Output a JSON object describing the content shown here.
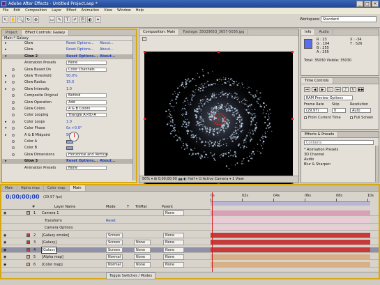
{
  "window": {
    "title": "Adobe After Effects - Untitled Project.aep *",
    "buttons": [
      "_",
      "□",
      "×"
    ]
  },
  "menu": [
    "File",
    "Edit",
    "Composition",
    "Layer",
    "Effect",
    "Animation",
    "View",
    "Window",
    "Help"
  ],
  "toolbar": {
    "workspace_label": "Workspace:",
    "workspace_value": "Standard",
    "tools": [
      "↖",
      "✋",
      "🔍",
      "↻",
      "⊕",
      "▭",
      "✎",
      "T",
      "✐",
      "⎘",
      "◐",
      "✦"
    ]
  },
  "effects_panel": {
    "tabs": [
      "Project",
      "Effect Controls: Galaxy"
    ],
    "subheader": "Main * Galaxy",
    "rows": [
      {
        "label": "Glow",
        "val": "Reset Options...",
        "val2": "About...",
        "head": false,
        "tri": "▸"
      },
      {
        "label": "Glow",
        "val": "Reset Options...",
        "val2": "About...",
        "head": false,
        "tri": "▸"
      },
      {
        "label": "Glow 2",
        "val": "Reset Options...",
        "val2": "About...",
        "head": true,
        "tri": "▾"
      },
      {
        "label": "Animation Presets",
        "dd": "None",
        "head": false,
        "tri": ""
      },
      {
        "label": "Glow Based On",
        "dd": "Color Channels",
        "head": false,
        "tri": "",
        "sw": true
      },
      {
        "label": "Glow Threshold",
        "val": "50.0%",
        "head": false,
        "tri": "▸",
        "sw": true
      },
      {
        "label": "Glow Radius",
        "val": "15.0",
        "head": false,
        "tri": "▸",
        "sw": true
      },
      {
        "label": "Glow Intensity",
        "val": "1.0",
        "head": false,
        "tri": "▸",
        "sw": true
      },
      {
        "label": "Composite Original",
        "dd": "Behind",
        "head": false,
        "tri": "",
        "sw": true
      },
      {
        "label": "Glow Operation",
        "dd": "Add",
        "head": false,
        "tri": "",
        "sw": true
      },
      {
        "label": "Glow Colors",
        "dd": "A & B Colors",
        "head": false,
        "tri": "",
        "sw": true
      },
      {
        "label": "Color Looping",
        "dd": "Triangle A>B>A",
        "head": false,
        "tri": "",
        "sw": true
      },
      {
        "label": "Color Loops",
        "val": "1.0",
        "head": false,
        "tri": "▸",
        "sw": true
      },
      {
        "label": "Color Phase",
        "val": "0x +0.0°",
        "head": false,
        "tri": "▾",
        "sw": true
      },
      {
        "label": "A & B Midpoint",
        "val": "50%",
        "head": false,
        "tri": "▸",
        "sw": true
      },
      {
        "label": "Color A",
        "chip": true,
        "head": false,
        "tri": "",
        "sw": true
      },
      {
        "label": "Color B",
        "chip": true,
        "head": false,
        "tri": "",
        "sw": true
      },
      {
        "label": "Glow Dimensions",
        "dd": "Horizontal and Vertical",
        "head": false,
        "tri": "",
        "sw": true
      },
      {
        "label": "Glow 3",
        "val": "Reset Options...",
        "val2": "About...",
        "head": true,
        "tri": "▸"
      },
      {
        "label": "Animation Presets",
        "dd": "None",
        "head": false,
        "tri": ""
      }
    ]
  },
  "comp_panel": {
    "tabs": [
      "Composition: Main",
      "Footage: 35029653_3657-5036.jpg"
    ],
    "active_camera": "Active Camera",
    "bottom_bar": "50%  ▾  ⊞  0;00;00;00  📷  ◐  Half  ▾  ⊡  Active Camera  ▾  1 View"
  },
  "info_panel": {
    "tabs": [
      "Info",
      "Audio"
    ],
    "r": "R : 23",
    "g": "G : 104",
    "b": "B : 255",
    "a": "A : 255",
    "x": "X : -34",
    "y": "Y : 526",
    "line1": "Total: 35030  Visible: 35030",
    "swatch": "#5a6cf0"
  },
  "time_panel": {
    "tabs": [
      "Time Controls"
    ],
    "ram_preview": "RAM Preview Options",
    "frame_rate_label": "Frame Rate",
    "skip_label": "Skip",
    "resolution_label": "Resolution",
    "frame_rate_val": "(29.97)",
    "skip_val": "0",
    "resolution_val": "Auto",
    "from_current": "From Current Time",
    "full_screen": "Full Screen"
  },
  "presets_panel": {
    "tabs": [
      "Effects & Presets"
    ],
    "search_placeholder": "Contains:",
    "items": [
      "* Animation Presets",
      "3D Channel",
      "Audio",
      "Blur & Sharpen"
    ]
  },
  "timeline": {
    "tabs": [
      "Main",
      "Alpha map",
      "Color map",
      "Main"
    ],
    "timecode": "0;00;00;00",
    "fps": "(29.97 fps)",
    "columns": [
      "#",
      "Layer Name",
      "Mode",
      "T",
      "TrkMat",
      "Parent"
    ],
    "ruler": [
      "0s",
      "02s",
      "04s",
      "06s",
      "08s",
      "10s"
    ],
    "layers": [
      {
        "num": "1",
        "name": "Camera 1",
        "mode": "",
        "trk": "",
        "parent": "None",
        "color": "#d9a0b8",
        "kind": "camera"
      },
      {
        "num": "",
        "name": "Transform",
        "mode": "Reset",
        "trk": "",
        "parent": "",
        "color": "#e8ccd8",
        "kind": "sub"
      },
      {
        "num": "",
        "name": "Camera Options",
        "mode": "",
        "trk": "",
        "parent": "",
        "color": "#e8ccd8",
        "kind": "sub"
      },
      {
        "num": "2",
        "name": "[Galaxy smoke]",
        "mode": "Screen",
        "trk": "",
        "parent": "None",
        "color": "#c83a3a",
        "kind": "layer"
      },
      {
        "num": "3",
        "name": "[Galaxy]",
        "mode": "Screen",
        "trk": "None",
        "parent": "None",
        "color": "#c83a3a",
        "kind": "layer"
      },
      {
        "num": "4",
        "name": "[Galaxy]",
        "mode": "Screen",
        "trk": "None",
        "parent": "None",
        "color": "#c83a3a",
        "kind": "selected"
      },
      {
        "num": "5",
        "name": "[Alpha map]",
        "mode": "Normal",
        "trk": "None",
        "parent": "None",
        "color": "#d8b088",
        "kind": "layer"
      },
      {
        "num": "6",
        "name": "[Color map]",
        "mode": "Normal",
        "trk": "None",
        "parent": "None",
        "color": "#d8b088",
        "kind": "layer"
      }
    ],
    "toggle_label": "Toggle Switches / Modes"
  }
}
